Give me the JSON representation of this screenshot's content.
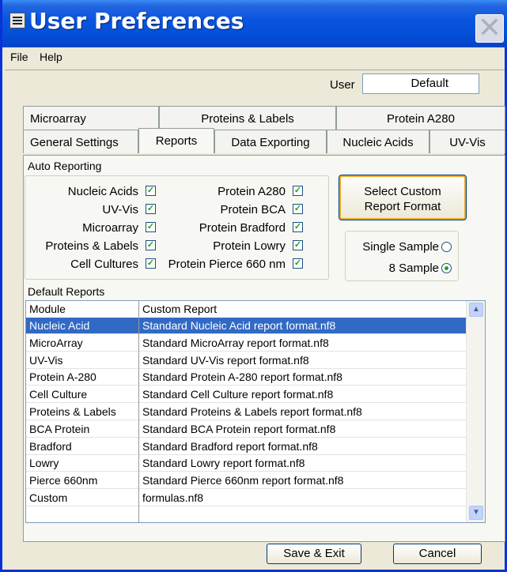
{
  "window": {
    "title": "User Preferences",
    "close_glyph": "✕"
  },
  "menu": {
    "file": "File",
    "help": "Help"
  },
  "user": {
    "label": "User",
    "value": "Default"
  },
  "tabs": {
    "row1": [
      "Microarray",
      "Proteins & Labels",
      "Protein A280"
    ],
    "row2": [
      "General Settings",
      "Reports",
      "Data Exporting",
      "Nucleic Acids",
      "UV-Vis"
    ],
    "active": "Reports"
  },
  "auto_reporting": {
    "label": "Auto Reporting",
    "left": [
      {
        "label": "Nucleic Acids",
        "checked": true
      },
      {
        "label": "UV-Vis",
        "checked": true
      },
      {
        "label": "Microarray",
        "checked": true
      },
      {
        "label": "Proteins & Labels",
        "checked": true
      },
      {
        "label": "Cell Cultures",
        "checked": true
      }
    ],
    "right": [
      {
        "label": "Protein A280",
        "checked": true
      },
      {
        "label": "Protein BCA",
        "checked": true
      },
      {
        "label": "Protein Bradford",
        "checked": true
      },
      {
        "label": "Protein Lowry",
        "checked": true
      },
      {
        "label": "Protein Pierce 660 nm",
        "checked": true
      }
    ]
  },
  "custom_button": {
    "line1": "Select Custom",
    "line2": "Report Format"
  },
  "sample_mode": {
    "options": [
      "Single Sample",
      "8 Sample"
    ],
    "selected": "8 Sample"
  },
  "default_reports": {
    "label": "Default Reports",
    "columns": [
      "Module",
      "Custom Report"
    ],
    "rows": [
      [
        "Nucleic Acid",
        "Standard Nucleic Acid report format.nf8"
      ],
      [
        "MicroArray",
        "Standard MicroArray report format.nf8"
      ],
      [
        "UV-Vis",
        "Standard UV-Vis report format.nf8"
      ],
      [
        "Protein A-280",
        "Standard Protein A-280 report format.nf8"
      ],
      [
        "Cell Culture",
        "Standard Cell Culture report format.nf8"
      ],
      [
        "Proteins & Labels",
        "Standard Proteins & Labels report format.nf8"
      ],
      [
        "BCA Protein",
        "Standard BCA Protein report format.nf8"
      ],
      [
        "Bradford",
        "Standard Bradford report format.nf8"
      ],
      [
        "Lowry",
        "Standard Lowry report format.nf8"
      ],
      [
        "Pierce 660nm",
        "Standard Pierce 660nm report format.nf8"
      ],
      [
        "Custom",
        "formulas.nf8"
      ]
    ],
    "selected_row": "Nucleic Acid"
  },
  "buttons": {
    "save": "Save & Exit",
    "cancel": "Cancel"
  }
}
